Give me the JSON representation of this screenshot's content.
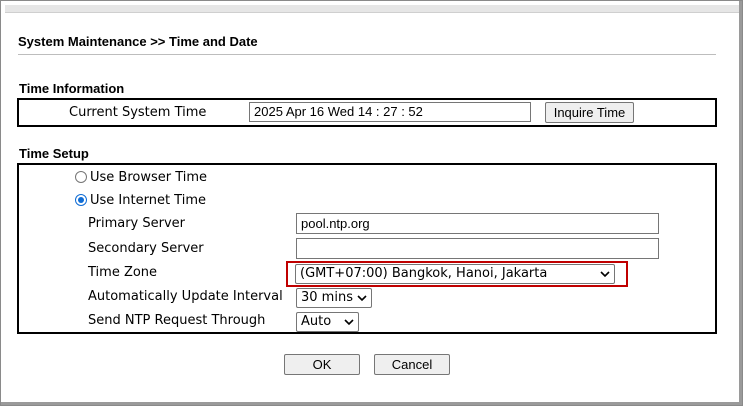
{
  "page": {
    "title": "System Maintenance >> Time and Date"
  },
  "time_information": {
    "section_title": "Time Information",
    "current_time_label": "Current System Time",
    "current_time_value": "2025 Apr 16 Wed 14 : 27 : 52",
    "inquire_button": "Inquire Time"
  },
  "time_setup": {
    "section_title": "Time Setup",
    "use_browser_time": {
      "label": "Use Browser Time",
      "selected": false
    },
    "use_internet_time": {
      "label": "Use Internet Time",
      "selected": true
    },
    "primary_server": {
      "label": "Primary Server",
      "value": "pool.ntp.org"
    },
    "secondary_server": {
      "label": "Secondary Server",
      "value": ""
    },
    "time_zone": {
      "label": "Time Zone",
      "value": "(GMT+07:00) Bangkok, Hanoi, Jakarta"
    },
    "update_interval": {
      "label": "Automatically Update Interval",
      "value": "30 mins"
    },
    "ntp_request": {
      "label": "Send NTP Request Through",
      "value": "Auto"
    }
  },
  "actions": {
    "ok": "OK",
    "cancel": "Cancel"
  },
  "colors": {
    "highlight": "#c00000",
    "radio_selected": "#0f6cd5"
  }
}
